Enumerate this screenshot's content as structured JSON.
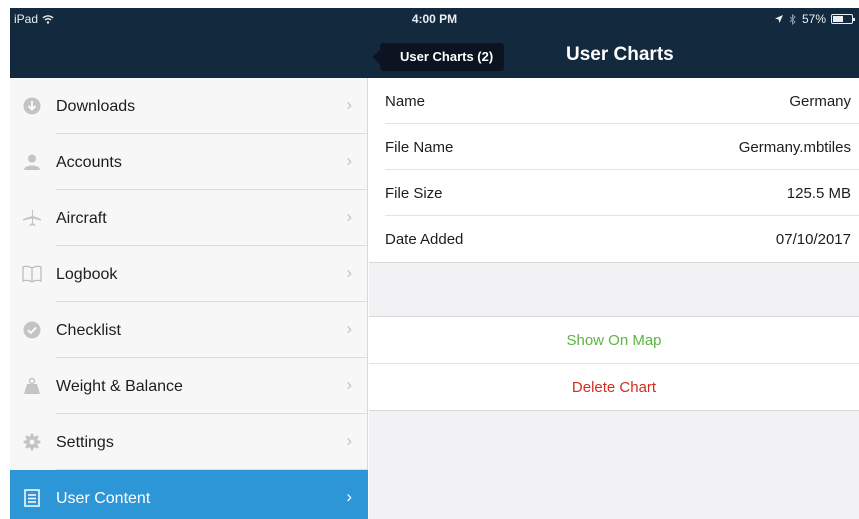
{
  "status_bar": {
    "device": "iPad",
    "time": "4:00 PM",
    "battery": "57%",
    "battery_level": 0.57
  },
  "nav": {
    "back_label": "User Charts (2)",
    "title": "User Charts"
  },
  "sidebar": {
    "items": [
      {
        "label": "Downloads",
        "icon": "download-icon"
      },
      {
        "label": "Accounts",
        "icon": "person-icon"
      },
      {
        "label": "Aircraft",
        "icon": "airplane-icon"
      },
      {
        "label": "Logbook",
        "icon": "book-icon"
      },
      {
        "label": "Checklist",
        "icon": "checkmark-icon"
      },
      {
        "label": "Weight & Balance",
        "icon": "weight-icon"
      },
      {
        "label": "Settings",
        "icon": "gear-icon"
      },
      {
        "label": "User Content",
        "icon": "document-icon",
        "selected": true
      }
    ]
  },
  "details": {
    "rows": [
      {
        "key": "Name",
        "value": "Germany"
      },
      {
        "key": "File Name",
        "value": "Germany.mbtiles"
      },
      {
        "key": "File Size",
        "value": "125.5 MB"
      },
      {
        "key": "Date Added",
        "value": "07/10/2017"
      }
    ]
  },
  "actions": {
    "show_on_map": "Show On Map",
    "delete_chart": "Delete Chart"
  },
  "colors": {
    "nav_bg": "#13293d",
    "selected_bg": "#2d96d6",
    "show_on_map": "#5bb543",
    "delete_chart": "#d62b1f"
  }
}
